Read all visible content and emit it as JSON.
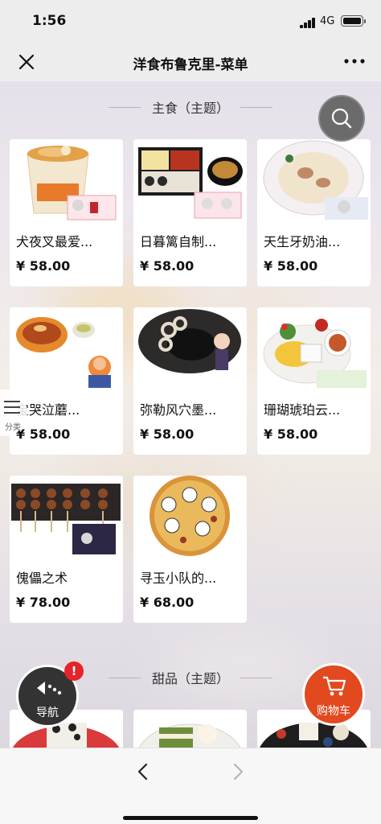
{
  "status_bar": {
    "time": "1:56",
    "network": "4G"
  },
  "nav": {
    "title": "洋食布鲁克里-菜单",
    "close_icon": "close-icon",
    "more_icon": "more-icon"
  },
  "sections": [
    {
      "label": "主食（主题）",
      "items": [
        {
          "name": "犬夜叉最爱...",
          "price": "¥ 58.00"
        },
        {
          "name": "日暮篱自制...",
          "price": "¥ 58.00"
        },
        {
          "name": "天生牙奶油...",
          "price": "¥ 58.00"
        },
        {
          "name": "宝哭泣蘑...",
          "price": "¥ 58.00"
        },
        {
          "name": "弥勒风穴墨...",
          "price": "¥ 58.00"
        },
        {
          "name": "珊瑚琥珀云...",
          "price": "¥ 58.00"
        },
        {
          "name": "傀儡之术",
          "price": "¥ 78.00"
        },
        {
          "name": "寻玉小队的...",
          "price": "¥ 68.00"
        }
      ]
    },
    {
      "label": "甜品（主题）"
    }
  ],
  "category_tab": {
    "label": "分类",
    "icon": "list-icon"
  },
  "nav_fab": {
    "label": "导航",
    "badge": "!",
    "icon": "navigation-dots-icon"
  },
  "cart_fab": {
    "label": "购物车",
    "icon": "cart-icon"
  },
  "search_fab": {
    "icon": "search-icon"
  },
  "bottom_bar": {
    "back_icon": "chevron-left-icon",
    "forward_icon": "chevron-right-icon"
  },
  "colors": {
    "accent": "#e2491f",
    "badge": "#e6232a",
    "nav_fab": "#333333",
    "search_fab": "#6b6b6b"
  }
}
